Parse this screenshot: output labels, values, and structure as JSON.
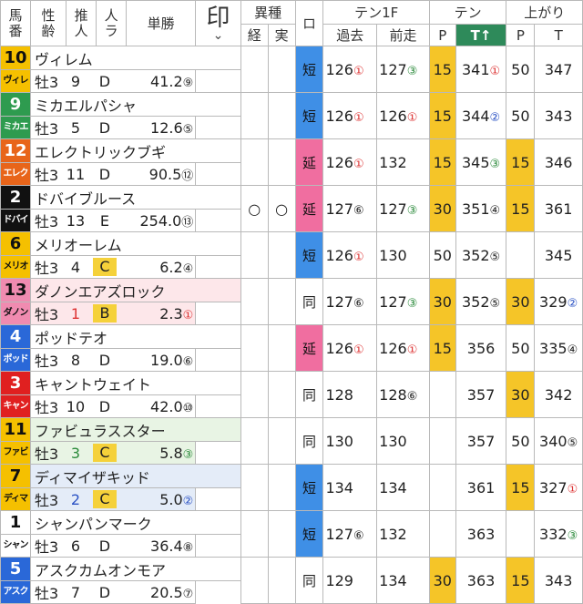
{
  "header": {
    "uma": "馬",
    "ban": "番",
    "sei": "性",
    "rei": "齢",
    "sui": "推",
    "nin": "人",
    "ninki1": "人",
    "ninki2": "ラ",
    "tansho": "単勝",
    "shirushi": "印",
    "ishu": "異種",
    "kei": "経",
    "jitsu": "実",
    "ro": "ロ",
    "ten1f": "テン1F",
    "kako": "過去",
    "zenso": "前走",
    "ten": "テン",
    "p1": "P",
    "tt": "T↑",
    "agari": "上がり",
    "p2": "P",
    "t": "T"
  },
  "colors": {
    "short": "#3f8fe6",
    "extend": "#f06ea0",
    "highlight": "#f5c528",
    "tt_header": "#2e8a5a"
  },
  "horses": [
    {
      "num": "10",
      "num_color": "#f5c000",
      "num_text": "#111",
      "abbr": "ヴィレ",
      "name": "ヴィレム",
      "sex": "牡3",
      "pop": "9",
      "rank": "D",
      "odds": "41.2",
      "odds_rank": "⑨",
      "rank_color": "",
      "rank_box": false,
      "kei": "",
      "jitsu": "",
      "ro": "短",
      "ro_type": "short",
      "kako": "126",
      "kako_r": "①",
      "kako_c": "red",
      "zenso": "127",
      "zenso_r": "③",
      "zenso_c": "green",
      "p1": "15",
      "p1_hl": true,
      "t": "341",
      "t_r": "①",
      "t_c": "red",
      "p2": "50",
      "p2_hl": false,
      "tt": "347",
      "tt_r": "",
      "tt_c": "",
      "row": ""
    },
    {
      "num": "9",
      "num_color": "#2e9b4f",
      "num_text": "#fff",
      "abbr": "ミカエ",
      "name": "ミカエルパシャ",
      "sex": "牡3",
      "pop": "5",
      "rank": "D",
      "odds": "12.6",
      "odds_rank": "⑤",
      "rank_color": "",
      "rank_box": false,
      "kei": "",
      "jitsu": "",
      "ro": "短",
      "ro_type": "short",
      "kako": "126",
      "kako_r": "①",
      "kako_c": "red",
      "zenso": "126",
      "zenso_r": "①",
      "zenso_c": "red",
      "p1": "15",
      "p1_hl": true,
      "t": "344",
      "t_r": "②",
      "t_c": "blue",
      "p2": "50",
      "p2_hl": false,
      "tt": "343",
      "tt_r": "",
      "tt_c": "",
      "row": ""
    },
    {
      "num": "12",
      "num_color": "#e8651a",
      "num_text": "#fff",
      "abbr": "エレク",
      "name": "エレクトリックブギ",
      "sex": "牡3",
      "pop": "11",
      "rank": "D",
      "odds": "90.5",
      "odds_rank": "⑫",
      "rank_color": "",
      "rank_box": false,
      "kei": "",
      "jitsu": "",
      "ro": "延",
      "ro_type": "extend",
      "kako": "126",
      "kako_r": "①",
      "kako_c": "red",
      "zenso": "132",
      "zenso_r": "",
      "zenso_c": "",
      "p1": "15",
      "p1_hl": true,
      "t": "345",
      "t_r": "③",
      "t_c": "green",
      "p2": "15",
      "p2_hl": true,
      "tt": "346",
      "tt_r": "",
      "tt_c": "",
      "row": ""
    },
    {
      "num": "2",
      "num_color": "#111111",
      "num_text": "#fff",
      "abbr": "ドバイ",
      "name": "ドバイブルース",
      "sex": "牡3",
      "pop": "13",
      "rank": "E",
      "odds": "254.0",
      "odds_rank": "⑬",
      "rank_color": "",
      "rank_box": false,
      "kei": "○",
      "jitsu": "○",
      "ro": "延",
      "ro_type": "extend",
      "kako": "127",
      "kako_r": "⑥",
      "kako_c": "",
      "zenso": "127",
      "zenso_r": "③",
      "zenso_c": "green",
      "p1": "30",
      "p1_hl": true,
      "t": "351",
      "t_r": "④",
      "t_c": "",
      "p2": "15",
      "p2_hl": true,
      "tt": "361",
      "tt_r": "",
      "tt_c": "",
      "row": ""
    },
    {
      "num": "6",
      "num_color": "#f5c000",
      "num_text": "#111",
      "abbr": "メリオ",
      "name": "メリオーレム",
      "sex": "牡3",
      "pop": "4",
      "rank": "C",
      "odds": "6.2",
      "odds_rank": "④",
      "rank_color": "",
      "rank_box": true,
      "kei": "",
      "jitsu": "",
      "ro": "短",
      "ro_type": "short",
      "kako": "126",
      "kako_r": "①",
      "kako_c": "red",
      "zenso": "130",
      "zenso_r": "",
      "zenso_c": "",
      "p1": "50",
      "p1_hl": false,
      "t": "352",
      "t_r": "⑤",
      "t_c": "",
      "p2": "",
      "p2_hl": false,
      "tt": "345",
      "tt_r": "",
      "tt_c": "",
      "row": ""
    },
    {
      "num": "13",
      "num_color": "#f08bb0",
      "num_text": "#111",
      "abbr": "ダノン",
      "name": "ダノンエアズロック",
      "sex": "牡3",
      "pop": "1",
      "rank": "B",
      "odds": "2.3",
      "odds_rank": "①",
      "rank_color": "red",
      "rank_box": true,
      "kei": "",
      "jitsu": "",
      "ro": "同",
      "ro_type": "same",
      "kako": "127",
      "kako_r": "⑥",
      "kako_c": "",
      "zenso": "127",
      "zenso_r": "③",
      "zenso_c": "green",
      "p1": "30",
      "p1_hl": true,
      "t": "352",
      "t_r": "⑤",
      "t_c": "",
      "p2": "30",
      "p2_hl": true,
      "tt": "329",
      "tt_r": "②",
      "tt_c": "blue",
      "row": "pink"
    },
    {
      "num": "4",
      "num_color": "#2a68d8",
      "num_text": "#fff",
      "abbr": "ポッド",
      "name": "ポッドテオ",
      "sex": "牡3",
      "pop": "8",
      "rank": "D",
      "odds": "19.0",
      "odds_rank": "⑥",
      "rank_color": "",
      "rank_box": false,
      "kei": "",
      "jitsu": "",
      "ro": "延",
      "ro_type": "extend",
      "kako": "126",
      "kako_r": "①",
      "kako_c": "red",
      "zenso": "126",
      "zenso_r": "①",
      "zenso_c": "red",
      "p1": "15",
      "p1_hl": true,
      "t": "356",
      "t_r": "",
      "t_c": "",
      "p2": "50",
      "p2_hl": false,
      "tt": "335",
      "tt_r": "④",
      "tt_c": "",
      "row": ""
    },
    {
      "num": "3",
      "num_color": "#e02020",
      "num_text": "#fff",
      "abbr": "キャン",
      "name": "キャントウェイト",
      "sex": "牡3",
      "pop": "10",
      "rank": "D",
      "odds": "42.0",
      "odds_rank": "⑩",
      "rank_color": "",
      "rank_box": false,
      "kei": "",
      "jitsu": "",
      "ro": "同",
      "ro_type": "same",
      "kako": "128",
      "kako_r": "",
      "kako_c": "",
      "zenso": "128",
      "zenso_r": "⑥",
      "zenso_c": "",
      "p1": "",
      "p1_hl": false,
      "t": "357",
      "t_r": "",
      "t_c": "",
      "p2": "30",
      "p2_hl": true,
      "tt": "342",
      "tt_r": "",
      "tt_c": "",
      "row": ""
    },
    {
      "num": "11",
      "num_color": "#f5c000",
      "num_text": "#111",
      "abbr": "ファビ",
      "name": "ファビュラススター",
      "sex": "牡3",
      "pop": "3",
      "rank": "C",
      "odds": "5.8",
      "odds_rank": "③",
      "rank_color": "green",
      "rank_box": true,
      "kei": "",
      "jitsu": "",
      "ro": "同",
      "ro_type": "same",
      "kako": "130",
      "kako_r": "",
      "kako_c": "",
      "zenso": "130",
      "zenso_r": "",
      "zenso_c": "",
      "p1": "",
      "p1_hl": false,
      "t": "357",
      "t_r": "",
      "t_c": "",
      "p2": "50",
      "p2_hl": false,
      "tt": "340",
      "tt_r": "⑤",
      "tt_c": "",
      "row": "green"
    },
    {
      "num": "7",
      "num_color": "#f5c000",
      "num_text": "#111",
      "abbr": "ディマ",
      "name": "ディマイザキッド",
      "sex": "牡3",
      "pop": "2",
      "rank": "C",
      "odds": "5.0",
      "odds_rank": "②",
      "rank_color": "blue",
      "rank_box": true,
      "kei": "",
      "jitsu": "",
      "ro": "短",
      "ro_type": "short",
      "kako": "134",
      "kako_r": "",
      "kako_c": "",
      "zenso": "134",
      "zenso_r": "",
      "zenso_c": "",
      "p1": "",
      "p1_hl": false,
      "t": "361",
      "t_r": "",
      "t_c": "",
      "p2": "15",
      "p2_hl": true,
      "tt": "327",
      "tt_r": "①",
      "tt_c": "red",
      "row": "blue"
    },
    {
      "num": "1",
      "num_color": "#ffffff",
      "num_text": "#111",
      "abbr": "シャン",
      "name": "シャンパンマーク",
      "sex": "牡3",
      "pop": "6",
      "rank": "D",
      "odds": "36.4",
      "odds_rank": "⑧",
      "rank_color": "",
      "rank_box": false,
      "kei": "",
      "jitsu": "",
      "ro": "短",
      "ro_type": "short",
      "kako": "127",
      "kako_r": "⑥",
      "kako_c": "",
      "zenso": "132",
      "zenso_r": "",
      "zenso_c": "",
      "p1": "",
      "p1_hl": false,
      "t": "363",
      "t_r": "",
      "t_c": "",
      "p2": "",
      "p2_hl": false,
      "tt": "332",
      "tt_r": "③",
      "tt_c": "green",
      "row": ""
    },
    {
      "num": "5",
      "num_color": "#2a68d8",
      "num_text": "#fff",
      "abbr": "アスク",
      "name": "アスクカムオンモア",
      "sex": "牡3",
      "pop": "7",
      "rank": "D",
      "odds": "20.5",
      "odds_rank": "⑦",
      "rank_color": "",
      "rank_box": false,
      "kei": "",
      "jitsu": "",
      "ro": "同",
      "ro_type": "same",
      "kako": "129",
      "kako_r": "",
      "kako_c": "",
      "zenso": "134",
      "zenso_r": "",
      "zenso_c": "",
      "p1": "30",
      "p1_hl": true,
      "t": "363",
      "t_r": "",
      "t_c": "",
      "p2": "15",
      "p2_hl": true,
      "tt": "343",
      "tt_r": "",
      "tt_c": "",
      "row": ""
    }
  ]
}
